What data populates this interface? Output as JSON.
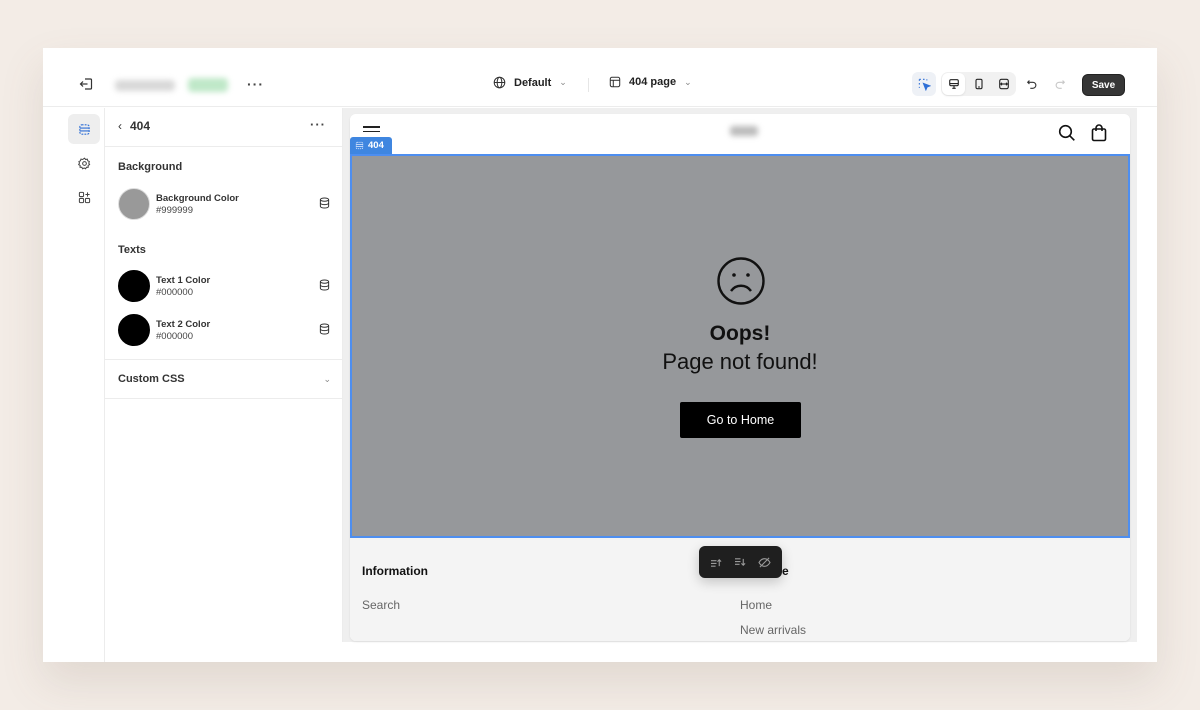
{
  "topbar": {
    "exit_icon": "exit-icon",
    "more_label": "···",
    "language_selector": {
      "icon": "globe-icon",
      "label": "Default"
    },
    "page_selector": {
      "icon": "page-template-icon",
      "label": "404 page"
    },
    "tools": {
      "select": "select-element-icon",
      "desktop": "desktop-icon",
      "mobile": "mobile-icon",
      "fullwidth": "fit-width-icon",
      "undo": "undo-icon",
      "redo": "redo-icon"
    },
    "save_label": "Save"
  },
  "rail": {
    "items": [
      {
        "name": "sections",
        "icon": "sections-icon",
        "active": true
      },
      {
        "name": "settings",
        "icon": "gear-icon",
        "active": false
      },
      {
        "name": "apps",
        "icon": "apps-add-icon",
        "active": false
      }
    ]
  },
  "panel": {
    "title": "404",
    "more_label": "···",
    "background": {
      "title": "Background",
      "items": [
        {
          "label": "Background Color",
          "value": "#999999",
          "swatch": "#999999"
        }
      ]
    },
    "texts": {
      "title": "Texts",
      "items": [
        {
          "label": "Text 1 Color",
          "value": "#000000",
          "swatch": "#000000"
        },
        {
          "label": "Text 2 Color",
          "value": "#000000",
          "swatch": "#000000"
        }
      ]
    },
    "custom_css": {
      "label": "Custom CSS"
    }
  },
  "preview": {
    "section_tag": "404",
    "hero": {
      "title": "Oops!",
      "subtitle": "Page not found!",
      "button_label": "Go to Home",
      "background": "#96989b"
    },
    "footer": {
      "columns": [
        {
          "heading": "Information",
          "links": [
            "Search"
          ]
        },
        {
          "heading": "e",
          "links": [
            "Home",
            "New arrivals"
          ]
        }
      ]
    },
    "floating_toolbar": [
      "move-up-icon",
      "move-down-icon",
      "hide-icon"
    ]
  },
  "colors": {
    "accent": "#3f86e0",
    "selection_border": "#4d8ef0",
    "save_bg": "#363636"
  }
}
